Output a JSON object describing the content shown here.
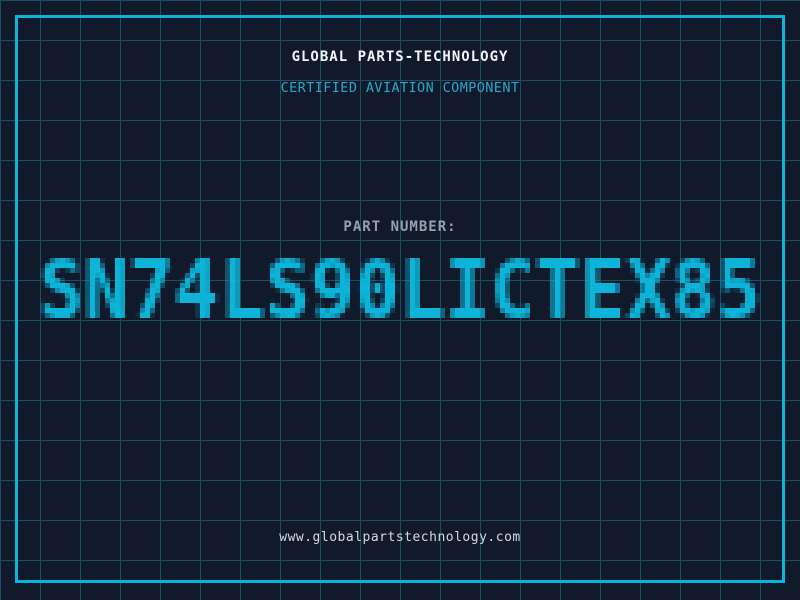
{
  "colors": {
    "background": "#101a2b",
    "grid_line": "#1d4d63",
    "frame": "#0cb4dc",
    "title": "#f2f4f6",
    "subtitle": "#2aa6cc",
    "label": "#98a0ac",
    "part_number": "#0db4d8",
    "url": "#d5dade"
  },
  "header": {
    "title": "GLOBAL PARTS-TECHNOLOGY",
    "subtitle": "CERTIFIED AVIATION COMPONENT"
  },
  "part": {
    "label": "PART NUMBER:",
    "number": "SN74LS90LICTEX85"
  },
  "footer": {
    "website": "www.globalpartstechnology.com"
  }
}
